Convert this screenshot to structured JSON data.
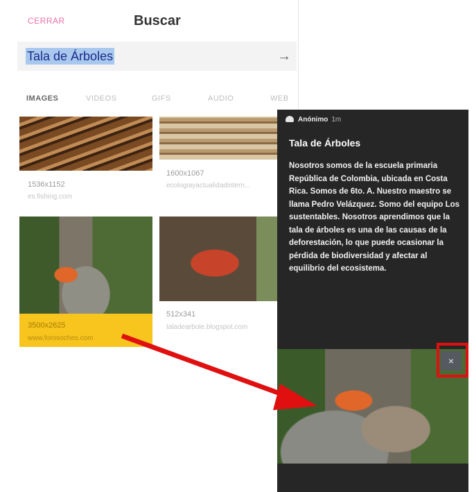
{
  "header": {
    "close_label": "CERRAR",
    "title": "Buscar"
  },
  "search": {
    "query": "Tala de Árboles",
    "submit_icon": "arrow-right-icon"
  },
  "tabs": [
    {
      "label": "IMAGES",
      "active": true
    },
    {
      "label": "VIDEOS",
      "active": false
    },
    {
      "label": "GIFS",
      "active": false
    },
    {
      "label": "AUDIO",
      "active": false
    },
    {
      "label": "WEB",
      "active": false
    }
  ],
  "results": [
    {
      "size": "1536x1152",
      "source": "es.fishing.com"
    },
    {
      "size": "1600x1067",
      "source": "ecologiayactualidadintern..."
    },
    {
      "size": "3500x2625",
      "source": "www.forosoches.com",
      "selected": true
    },
    {
      "size": "512x341",
      "source": "taladearbole.blogspot.com"
    }
  ],
  "post": {
    "author": "Anónimo",
    "time": "1m",
    "title": "Tala de Árboles",
    "body": "Nosotros somos de la escuela primaria República de Colombia, ubicada en Costa Rica. Somos de 6to. A. Nuestro maestro se llama Pedro Velázquez. Somo del equipo Los sustentables. Nosotros aprendimos que la tala de árboles es una de las causas de la deforestación, lo que puede ocasionar la pérdida de biodiversidad y afectar al equilibrio del ecosistema.",
    "close_symbol": "×"
  },
  "colors": {
    "accent_pink": "#f06fa8",
    "selected_card": "#f7c51e",
    "annotation_red": "#e01010",
    "panel_bg": "#262626"
  }
}
